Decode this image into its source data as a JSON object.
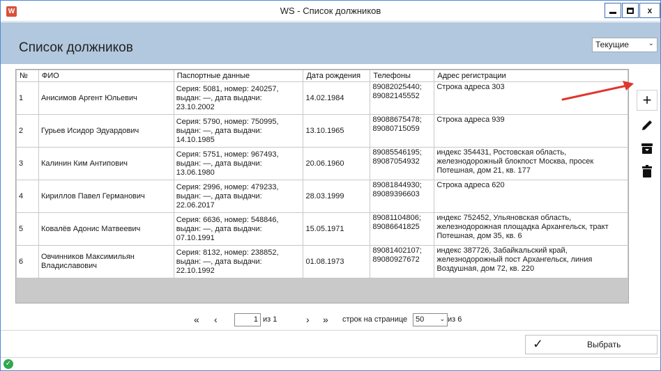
{
  "window": {
    "title": "WS - Список должников",
    "app_icon": "W",
    "controls": {
      "minimize": "minimize-icon",
      "maximize": "maximize-icon",
      "close": "x"
    }
  },
  "header": {
    "title": "Список должников",
    "filter": {
      "value": "Текущие",
      "icon": "chevron-down-icon"
    }
  },
  "table": {
    "columns": [
      "№",
      "ФИО",
      "Паспортные данные",
      "Дата рождения",
      "Телефоны",
      "Адрес регистрации"
    ],
    "rows": [
      {
        "num": "1",
        "fio": "Анисимов Аргент Юльевич",
        "passport": "Серия: 5081, номер: 240257, выдан: —, дата выдачи: 23.10.2002",
        "birth": "14.02.1984",
        "phones": "89082025440; 89082145552",
        "address": "Строка адреса 303"
      },
      {
        "num": "2",
        "fio": "Гурьев Исидор Эдуардович",
        "passport": "Серия: 5790, номер: 750995, выдан: —, дата выдачи: 14.10.1985",
        "birth": "13.10.1965",
        "phones": "89088675478; 89080715059",
        "address": "Строка адреса 939"
      },
      {
        "num": "3",
        "fio": "Калинин Ким Антипович",
        "passport": "Серия: 5751, номер: 967493, выдан: —, дата выдачи: 13.06.1980",
        "birth": "20.06.1960",
        "phones": "89085546195; 89087054932",
        "address": "индекс 354431, Ростовская область, железнодорожный блокпост Москва, просек Потешная, дом 21, кв. 177"
      },
      {
        "num": "4",
        "fio": "Кириллов Павел Германович",
        "passport": "Серия: 2996, номер: 479233, выдан: —, дата выдачи: 22.06.2017",
        "birth": "28.03.1999",
        "phones": "89081844930; 89089396603",
        "address": "Строка адреса 620"
      },
      {
        "num": "5",
        "fio": "Ковалёв Адонис Матвеевич",
        "passport": "Серия: 6636, номер: 548846, выдан: —, дата выдачи: 07.10.1991",
        "birth": "15.05.1971",
        "phones": "89081104806; 89086641825",
        "address": "индекс 752452, Ульяновская область, железнодорожная площадка Архангельск, тракт Потешная, дом 35, кв. 6"
      },
      {
        "num": "6",
        "fio": "Овчинников Максимильян Владиславович",
        "passport": "Серия: 8132, номер: 238852, выдан: —, дата выдачи: 22.10.1992",
        "birth": "01.08.1973",
        "phones": "89081402107; 89080927672",
        "address": "индекс 387726, Забайкальский край, железнодорожный пост Архангельск, линия Воздушная, дом 72, кв. 220"
      }
    ]
  },
  "sidebar": {
    "add": {
      "label": "+",
      "icon": "plus-icon"
    },
    "edit": {
      "icon": "pencil-icon"
    },
    "archive": {
      "icon": "archive-icon"
    },
    "delete": {
      "icon": "trash-icon"
    }
  },
  "annotation": {
    "color": "#e0362c"
  },
  "pager": {
    "first": "«",
    "prev": "‹",
    "page": "1",
    "of_pages": "из 1",
    "next": "›",
    "last": "»",
    "rows_label": "строк на странице",
    "rows_per_page": "50",
    "of_total": "из 6"
  },
  "footer": {
    "choose_label": "Выбрать",
    "choose_icon": "check-icon",
    "status_icon": "status-ok-icon"
  },
  "colors": {
    "header_bg": "#b2c8de",
    "window_border": "#4b8ad6",
    "status_ok": "#2fa84f"
  }
}
